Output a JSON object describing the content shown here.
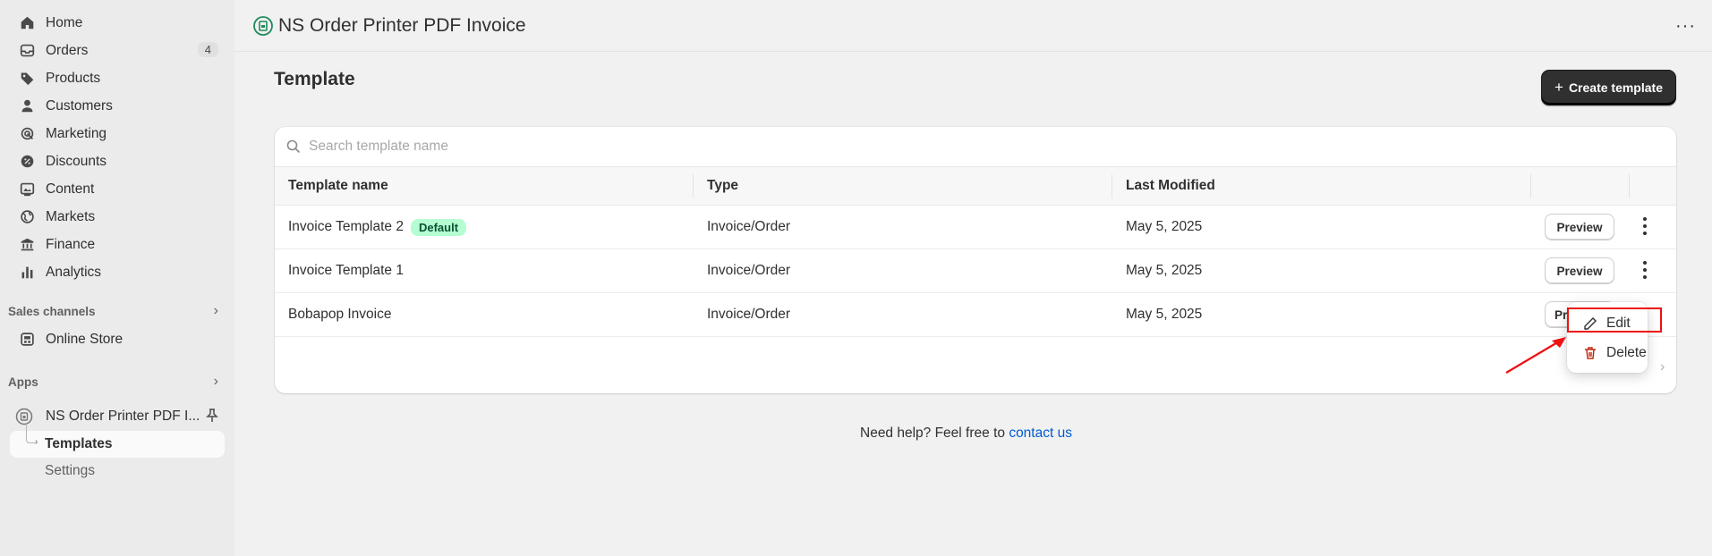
{
  "sidebar": {
    "nav": [
      {
        "label": "Home",
        "icon": "home-icon"
      },
      {
        "label": "Orders",
        "icon": "inbox-icon",
        "badge": "4"
      },
      {
        "label": "Products",
        "icon": "tag-icon"
      },
      {
        "label": "Customers",
        "icon": "person-icon"
      },
      {
        "label": "Marketing",
        "icon": "target-icon"
      },
      {
        "label": "Discounts",
        "icon": "discount-icon"
      },
      {
        "label": "Content",
        "icon": "image-icon"
      },
      {
        "label": "Markets",
        "icon": "globe-icon"
      },
      {
        "label": "Finance",
        "icon": "bank-icon"
      },
      {
        "label": "Analytics",
        "icon": "bar-chart-icon"
      }
    ],
    "sales_channels_title": "Sales channels",
    "online_store": "Online Store",
    "apps_title": "Apps",
    "app_name": "NS Order Printer PDF I...",
    "templates": "Templates",
    "settings": "Settings"
  },
  "topbar": {
    "title": "NS Order Printer PDF Invoice"
  },
  "main": {
    "title": "Template",
    "create_button": "Create template",
    "search_placeholder": "Search template name",
    "columns": [
      "Template name",
      "Type",
      "Last Modified"
    ],
    "rows": [
      {
        "name": "Invoice Template 2",
        "badge": "Default",
        "type": "Invoice/Order",
        "modified": "May 5, 2025",
        "action": "Preview"
      },
      {
        "name": "Invoice Template 1",
        "type": "Invoice/Order",
        "modified": "May 5, 2025",
        "action": "Preview"
      },
      {
        "name": "Bobapop Invoice",
        "type": "Invoice/Order",
        "modified": "May 5, 2025",
        "action": "Pre"
      }
    ],
    "popover": {
      "edit": "Edit",
      "delete": "Delete"
    },
    "help_text": "Need help? Feel free to",
    "help_link": "contact us"
  },
  "colors": {
    "accent": "#303030",
    "link": "#005bd3",
    "badge_bg": "#b4fed2",
    "annotation": "#ee1111"
  }
}
